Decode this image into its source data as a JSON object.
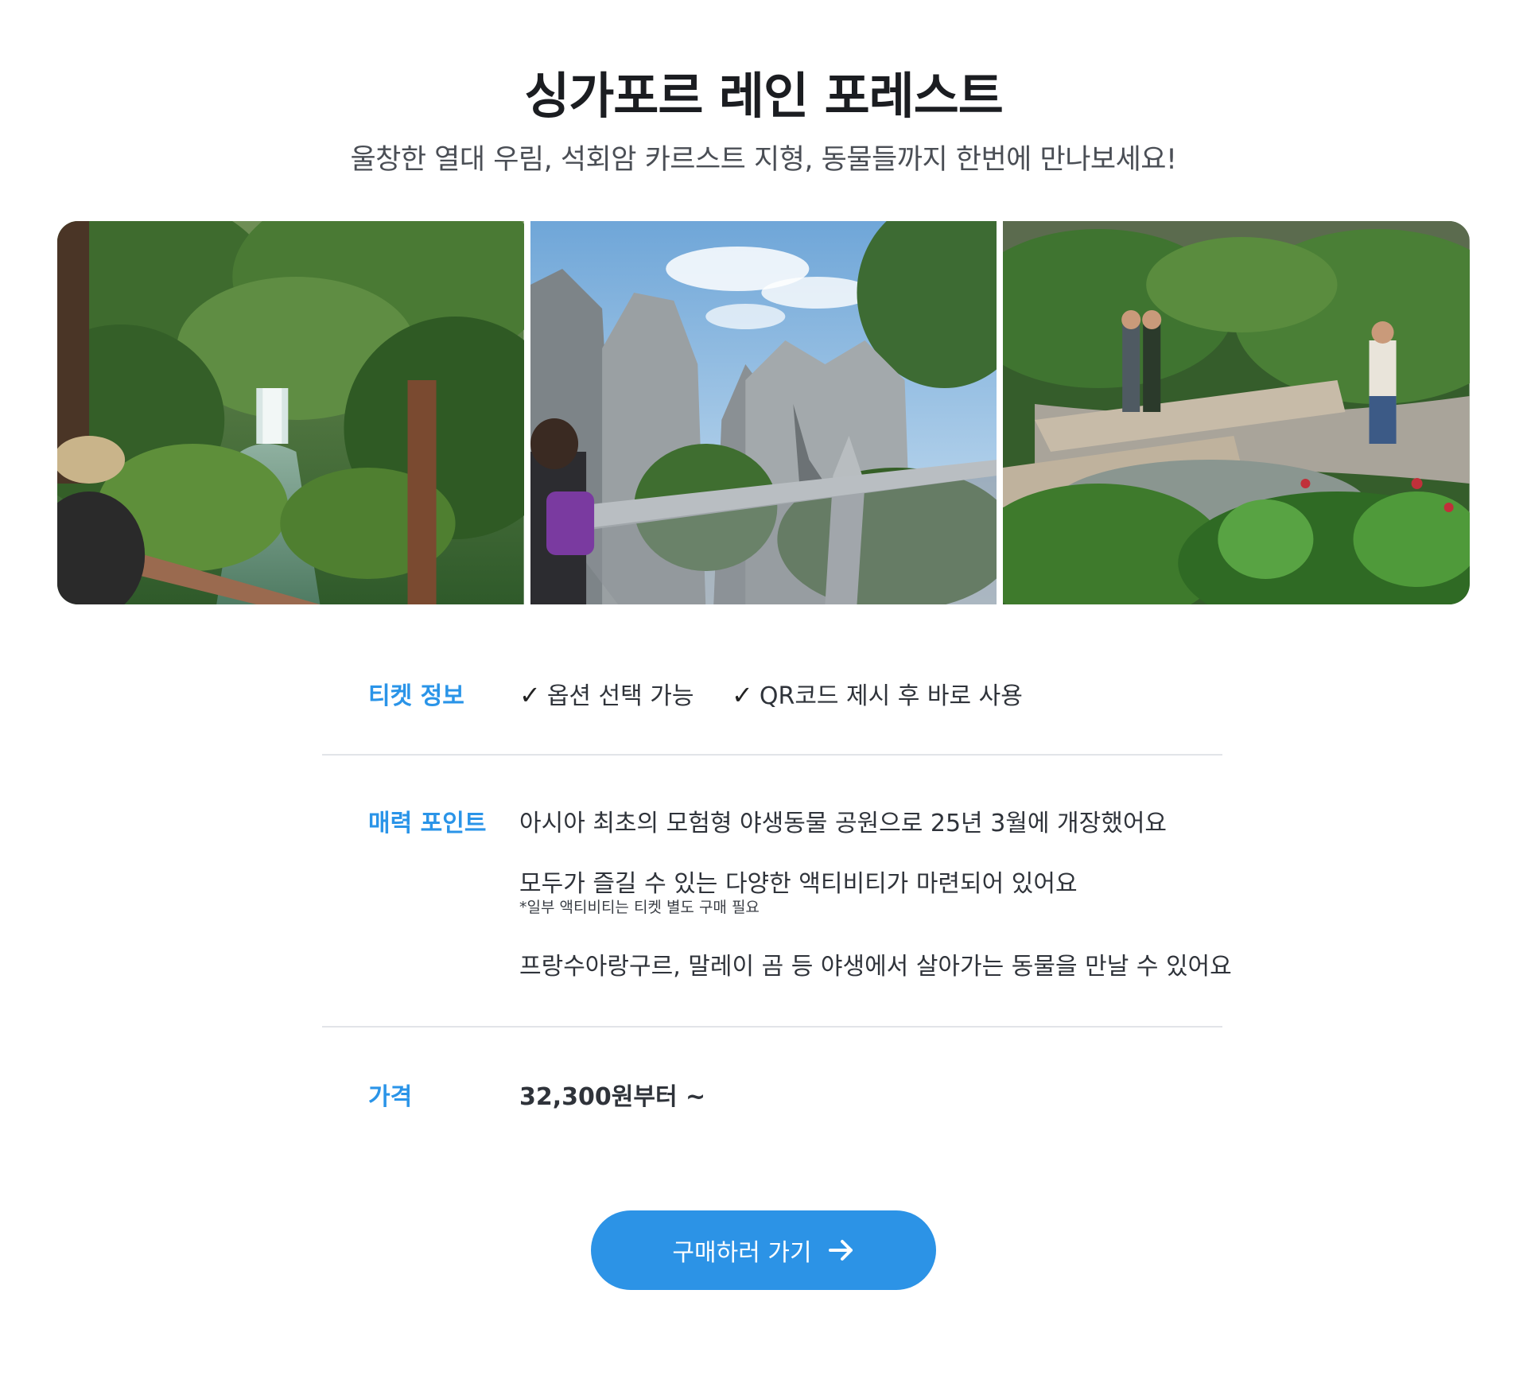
{
  "header": {
    "title": "싱가포르 레인 포레스트",
    "subtitle": "울창한 열대 우림, 석회암 카르스트 지형, 동물들까지 한번에 만나보세요!"
  },
  "gallery": {
    "images": [
      {
        "name": "rainforest-waterfall-photo"
      },
      {
        "name": "limestone-karst-photo"
      },
      {
        "name": "jungle-stream-photo"
      }
    ]
  },
  "ticket_info": {
    "label": "티켓 정보",
    "checkmark": "✓",
    "items": [
      "옵션 선택 가능",
      "QR코드 제시 후 바로 사용"
    ]
  },
  "highlights": {
    "label": "매력 포인트",
    "point_1": "아시아 최초의 모험형 야생동물 공원으로 25년 3월에 개장했어요",
    "point_2": "모두가 즐길 수 있는 다양한 액티비티가 마련되어 있어요",
    "point_2_note": "*일부 액티비티는 티켓 별도 구매 필요",
    "point_3": "프랑수아랑구르, 말레이 곰 등 야생에서 살아가는 동물을 만날 수 있어요"
  },
  "price": {
    "label": "가격",
    "value": "32,300원부터 ~"
  },
  "cta": {
    "label": "구매하러 가기",
    "icon": "arrow-right-icon"
  },
  "colors": {
    "accent": "#2c93e6",
    "label_blue": "#2a94e8",
    "divider": "#e2e4e8"
  }
}
